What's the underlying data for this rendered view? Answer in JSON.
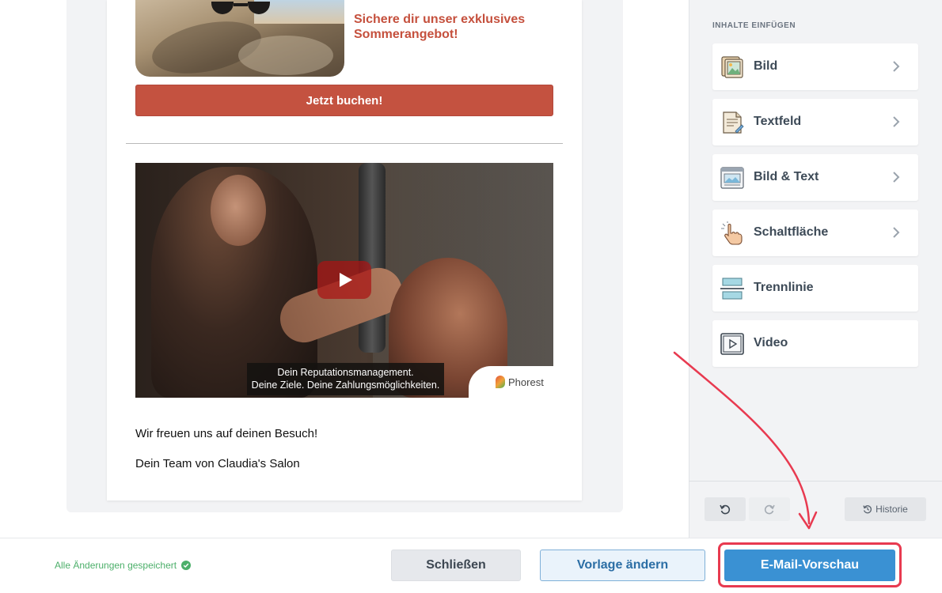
{
  "email": {
    "promo_title": "Sichere dir unser exklusives Sommerangebot!",
    "cta_label": "Jetzt buchen!",
    "video": {
      "caption_line1": "Dein Reputationsmanagement.",
      "caption_line2": "Deine Ziele. Deine Zahlungsmöglichkeiten.",
      "brand": "Phorest",
      "play_icon": "play-icon"
    },
    "closing_line1": "Wir freuen uns auf deinen Besuch!",
    "closing_line2": "Dein Team von Claudia's Salon"
  },
  "panel": {
    "title": "INHALTE EINFÜGEN",
    "blocks": [
      {
        "label": "Bild",
        "icon": "image-icon",
        "has_chevron": true
      },
      {
        "label": "Textfeld",
        "icon": "text-document-icon",
        "has_chevron": true
      },
      {
        "label": "Bild & Text",
        "icon": "image-text-icon",
        "has_chevron": true
      },
      {
        "label": "Schaltfläche",
        "icon": "pointer-hand-icon",
        "has_chevron": true
      },
      {
        "label": "Trennlinie",
        "icon": "divider-icon",
        "has_chevron": false
      },
      {
        "label": "Video",
        "icon": "video-play-icon",
        "has_chevron": false
      }
    ],
    "history_label": "Historie"
  },
  "footer": {
    "saved_status": "Alle Änderungen gespeichert",
    "close_label": "Schließen",
    "change_template_label": "Vorlage ändern",
    "preview_label": "E-Mail-Vorschau"
  },
  "colors": {
    "accent_red": "#c45240",
    "primary_blue": "#3a91d3",
    "success_green": "#4caf6a",
    "annotation_red": "#e83a50"
  }
}
